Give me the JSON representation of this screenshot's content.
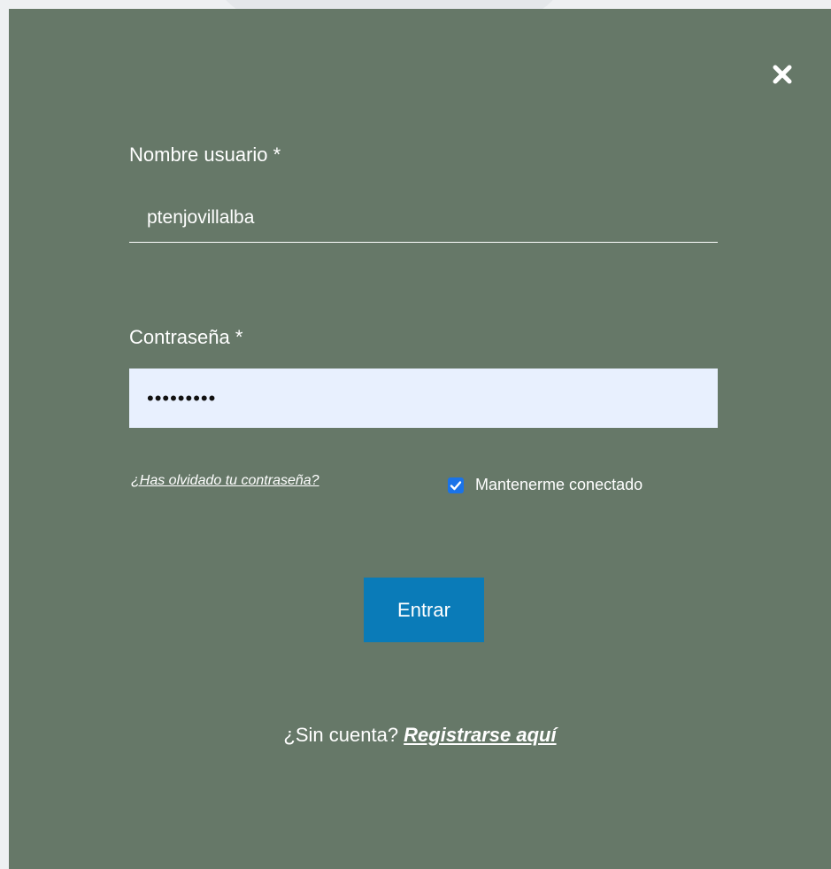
{
  "modal": {
    "close_icon": "close-icon",
    "background_color": "#667868"
  },
  "form": {
    "username_label": "Nombre usuario *",
    "username_value": "ptenjovillalba",
    "password_label": "Contraseña *",
    "password_value": "•••••••••",
    "forgot_password_link": "¿Has olvidado tu contraseña?",
    "remember_me_label": "Mantenerme conectado",
    "remember_me_checked": true,
    "submit_label": "Entrar",
    "submit_color": "#0a7bb8"
  },
  "footer": {
    "no_account_text": "¿Sin cuenta? ",
    "register_link": "Registrarse aquí"
  }
}
